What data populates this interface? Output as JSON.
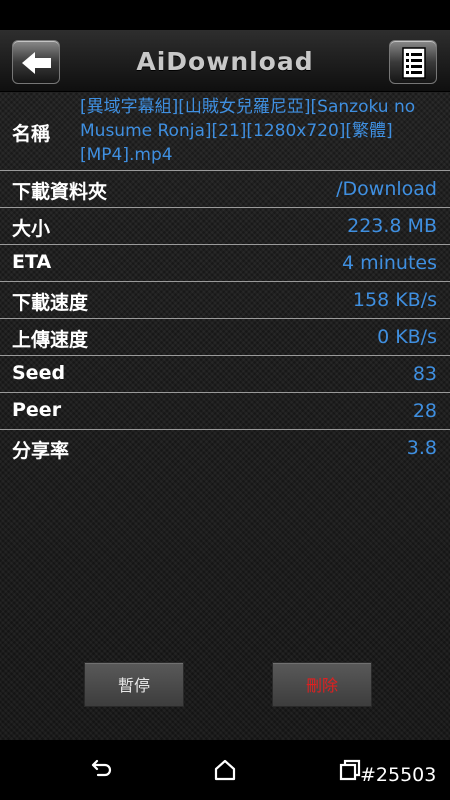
{
  "app": {
    "title": "AiDownload",
    "back_icon": "arrow-left-icon",
    "menu_icon": "document-list-icon"
  },
  "details": {
    "name_label": "名稱",
    "name_value": "[異域字幕組][山賊女兒羅尼亞][Sanzoku no Musume Ronja][21][1280x720][繁體][MP4].mp4",
    "folder_label": "下載資料夾",
    "folder_value": "/Download",
    "size_label": "大小",
    "size_value": "223.8 MB",
    "eta_label": "ETA",
    "eta_value": "4 minutes",
    "download_speed_label": "下載速度",
    "download_speed_value": "158 KB/s",
    "upload_speed_label": "上傳速度",
    "upload_speed_value": "0 KB/s",
    "seed_label": "Seed",
    "seed_value": "83",
    "peer_label": "Peer",
    "peer_value": "28",
    "ratio_label": "分享率",
    "ratio_value": "3.8"
  },
  "actions": {
    "pause_label": "暫停",
    "delete_label": "刪除"
  },
  "navbar": {
    "back_icon": "nav-back-icon",
    "home_icon": "nav-home-icon",
    "recent_icon": "nav-recent-apps-icon"
  },
  "watermark": "#25503",
  "colors": {
    "value_text": "#3f8fe0",
    "delete_text": "#e02020"
  }
}
